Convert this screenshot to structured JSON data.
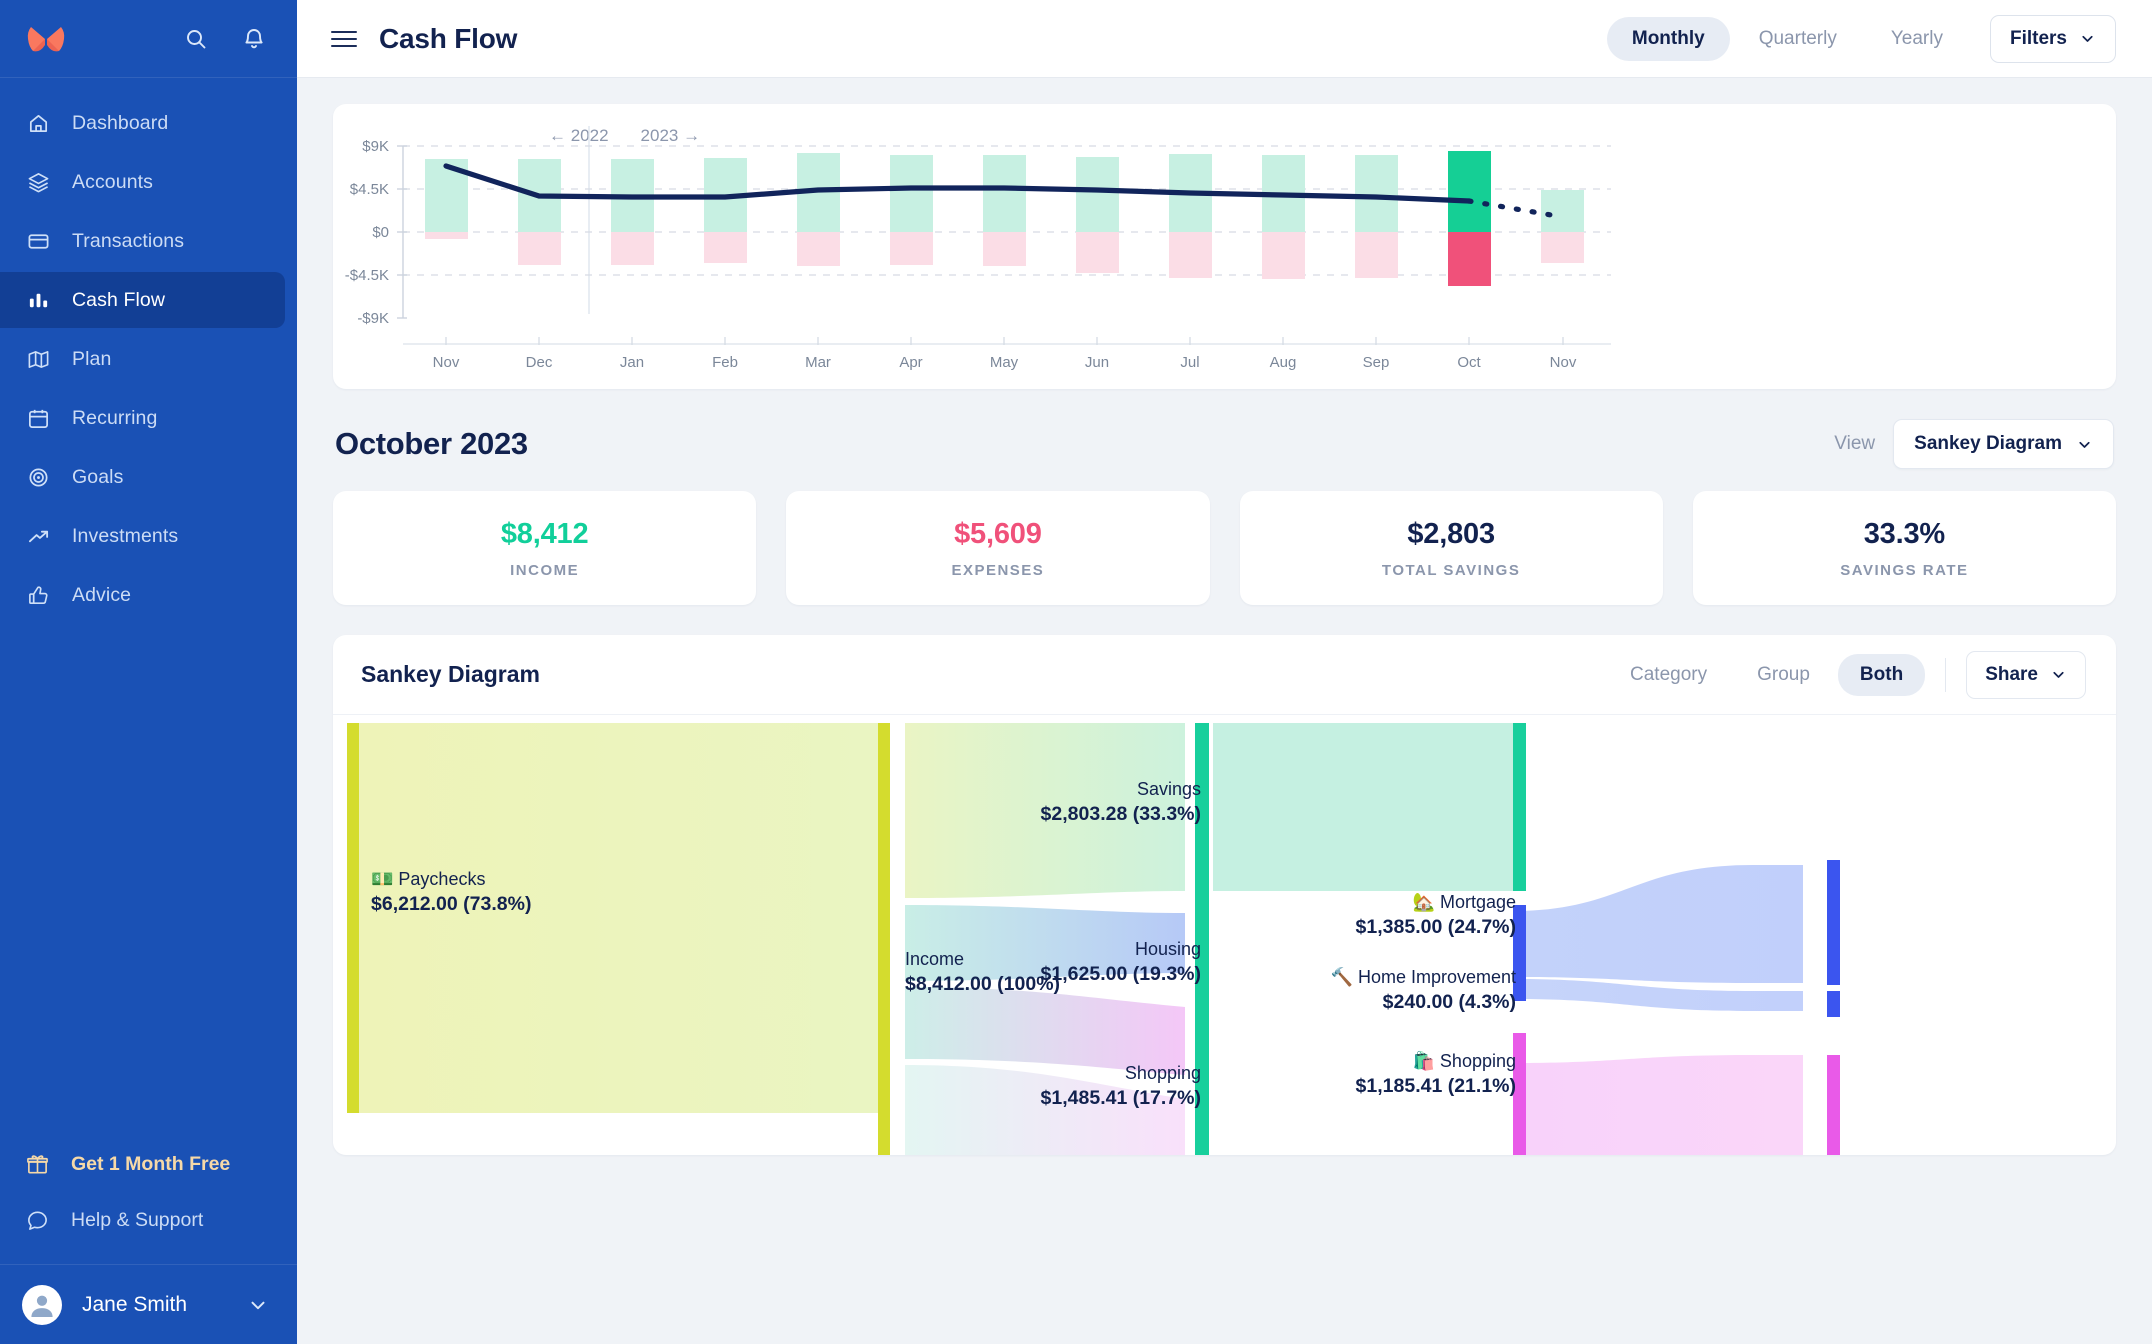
{
  "sidebar": {
    "logo_name": "monarch-butterfly-logo",
    "search_icon": "search-icon",
    "bell_icon": "bell-icon",
    "items": [
      {
        "label": "Dashboard",
        "icon": "home-icon",
        "active": false
      },
      {
        "label": "Accounts",
        "icon": "layers-icon",
        "active": false
      },
      {
        "label": "Transactions",
        "icon": "credit-card-icon",
        "active": false
      },
      {
        "label": "Cash Flow",
        "icon": "bar-chart-icon",
        "active": true
      },
      {
        "label": "Plan",
        "icon": "map-icon",
        "active": false
      },
      {
        "label": "Recurring",
        "icon": "calendar-icon",
        "active": false
      },
      {
        "label": "Goals",
        "icon": "target-icon",
        "active": false
      },
      {
        "label": "Investments",
        "icon": "trending-up-icon",
        "active": false
      },
      {
        "label": "Advice",
        "icon": "thumbs-up-icon",
        "active": false
      }
    ],
    "promo": "Get 1 Month Free",
    "help": "Help & Support",
    "user": "Jane Smith"
  },
  "topbar": {
    "title": "Cash Flow",
    "periods": [
      {
        "label": "Monthly",
        "active": true
      },
      {
        "label": "Quarterly",
        "active": false
      },
      {
        "label": "Yearly",
        "active": false
      }
    ],
    "filters_label": "Filters"
  },
  "overview": {
    "prev_year": "← 2022",
    "next_year": "2023 →"
  },
  "month": {
    "title": "October 2023",
    "view_label": "View",
    "view_value": "Sankey Diagram"
  },
  "stats": [
    {
      "value": "$8,412",
      "label": "INCOME",
      "color": "#11cf9a"
    },
    {
      "value": "$5,609",
      "label": "EXPENSES",
      "color": "#f0517a"
    },
    {
      "value": "$2,803",
      "label": "TOTAL SAVINGS",
      "color": "#12224f"
    },
    {
      "value": "33.3%",
      "label": "SAVINGS RATE",
      "color": "#12224f"
    }
  ],
  "sankey_panel": {
    "title": "Sankey Diagram",
    "tabs": [
      {
        "label": "Category",
        "active": false
      },
      {
        "label": "Group",
        "active": false
      },
      {
        "label": "Both",
        "active": true
      }
    ],
    "share_label": "Share"
  },
  "sankey_nodes": {
    "paychecks": {
      "name": "💵 Paychecks",
      "value": "$6,212.00 (73.8%)"
    },
    "income": {
      "name": "Income",
      "value": "$8,412.00 (100%)"
    },
    "savings": {
      "name": "Savings",
      "value": "$2,803.28 (33.3%)"
    },
    "housing": {
      "name": "Housing",
      "value": "$1,625.00 (19.3%)"
    },
    "shopping_group": {
      "name": "Shopping",
      "value": "$1,485.41 (17.7%)"
    },
    "mortgage": {
      "name": "🏡 Mortgage",
      "value": "$1,385.00 (24.7%)"
    },
    "home_improvement": {
      "name": "🔨 Home Improvement",
      "value": "$240.00 (4.3%)"
    },
    "shopping": {
      "name": "🛍️ Shopping",
      "value": "$1,185.41 (21.1%)"
    }
  },
  "chart_data": {
    "type": "bar",
    "title": "",
    "xlabel": "",
    "ylabel": "",
    "ylim": [
      -9000,
      9000
    ],
    "ytick_labels": [
      "$9K",
      "$4.5K",
      "$0",
      "-$4.5K",
      "-$9K"
    ],
    "ytick_values": [
      9000,
      4500,
      0,
      -4500,
      -9000
    ],
    "grid": true,
    "categories": [
      "Nov",
      "Dec",
      "Jan",
      "Feb",
      "Mar",
      "Apr",
      "May",
      "Jun",
      "Jul",
      "Aug",
      "Sep",
      "Oct",
      "Nov"
    ],
    "series": [
      {
        "name": "Income",
        "values": [
          7650,
          7650,
          7650,
          7800,
          8200,
          7950,
          8000,
          7750,
          8100,
          7950,
          8000,
          8412,
          4400
        ]
      },
      {
        "name": "Expenses",
        "values": [
          -700,
          -3400,
          -3400,
          -3250,
          -3500,
          -3450,
          -3500,
          -4300,
          -4750,
          -4900,
          -4750,
          -5609,
          -3200
        ]
      },
      {
        "name": "Savings (line)",
        "values": [
          6900,
          4200,
          4200,
          4200,
          4600,
          4700,
          4700,
          4600,
          4450,
          4350,
          4200,
          4000,
          2600
        ],
        "style": "line"
      }
    ],
    "projection_from": "Oct",
    "highlight_category": "Oct",
    "colors": {
      "income_bar": "#c7f0e2",
      "expense_bar": "#fcdce5",
      "income_bar_highlight": "#15cf95",
      "expense_bar_highlight": "#f0517a",
      "line": "#11245b"
    }
  },
  "sankey_chart_data": {
    "type": "sankey",
    "nodes": [
      "Paychecks",
      "Income",
      "Savings",
      "Housing",
      "Shopping",
      "Mortgage",
      "Home Improvement",
      "Shopping (category)"
    ],
    "links": [
      {
        "source": "Paychecks",
        "target": "Income",
        "value": 6212.0,
        "percent": 73.8
      },
      {
        "source": "Income",
        "target": "Savings",
        "value": 2803.28,
        "percent": 33.3
      },
      {
        "source": "Income",
        "target": "Housing",
        "value": 1625.0,
        "percent": 19.3
      },
      {
        "source": "Income",
        "target": "Shopping",
        "value": 1485.41,
        "percent": 17.7
      },
      {
        "source": "Housing",
        "target": "Mortgage",
        "value": 1385.0,
        "percent": 24.7
      },
      {
        "source": "Housing",
        "target": "Home Improvement",
        "value": 240.0,
        "percent": 4.3
      },
      {
        "source": "Shopping",
        "target": "Shopping (category)",
        "value": 1185.41,
        "percent": 21.1
      }
    ],
    "total_income": 8412.0
  }
}
